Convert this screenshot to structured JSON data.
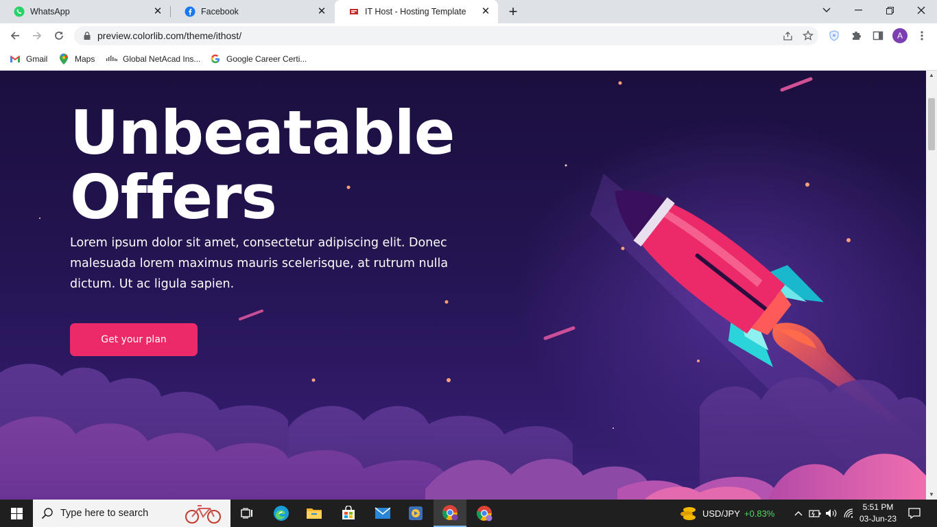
{
  "browser": {
    "tabs": [
      {
        "title": "WhatsApp",
        "close": "✕",
        "active": false
      },
      {
        "title": "Facebook",
        "close": "✕",
        "active": false
      },
      {
        "title": "IT Host - Hosting Template",
        "close": "✕",
        "active": true
      }
    ],
    "new_tab": "+",
    "url": "preview.colorlib.com/theme/ithost/",
    "profile_initial": "A",
    "bookmarks": [
      "Gmail",
      "Maps",
      "Global NetAcad Ins...",
      "Google Career Certi..."
    ]
  },
  "hero": {
    "title_line1": "Unbeatable",
    "title_line2": "Offers",
    "text": "Lorem ipsum dolor sit amet, consectetur adipiscing elit. Donec malesuada lorem maximus mauris scelerisque, at rutrum nulla dictum. Ut ac ligula sapien.",
    "button": "Get your plan"
  },
  "colors": {
    "accent": "#ec2a6a",
    "background": "#241452",
    "rocket_body": "#ec2a6a",
    "rocket_fins": "#2ad4d8"
  },
  "taskbar": {
    "search_placeholder": "Type here to search",
    "ticker_symbol": "USD/JPY",
    "ticker_change": "+0.83%",
    "time": "5:51 PM",
    "date": "03-Jun-23",
    "apps": [
      "task-view-icon",
      "edge-icon",
      "file-explorer-icon",
      "store-icon",
      "mail-icon",
      "media-player-icon",
      "chrome-icon",
      "chrome-profile-icon"
    ]
  }
}
